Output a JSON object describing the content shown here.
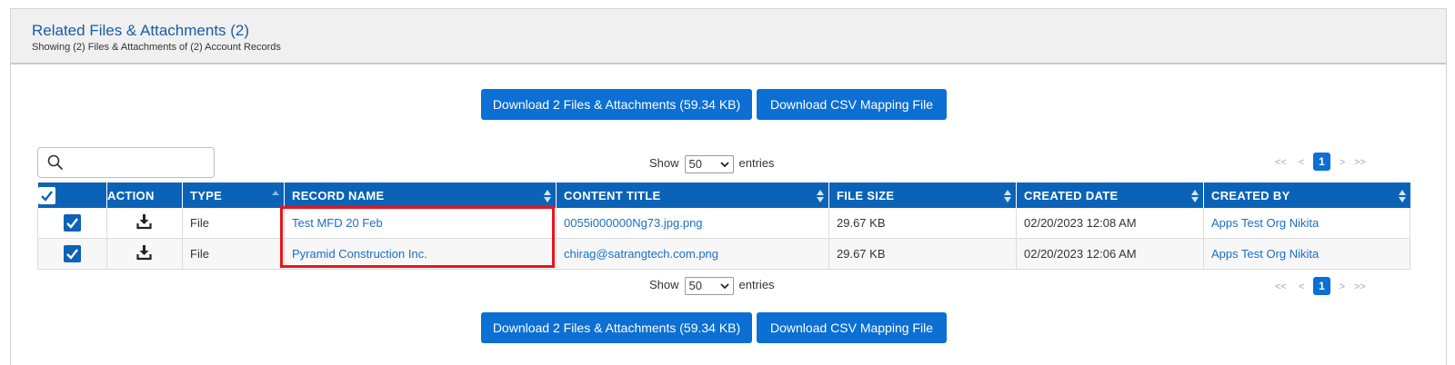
{
  "header": {
    "title": "Related Files & Attachments (2)",
    "subtitle": "Showing (2) Files & Attachments of (2) Account Records"
  },
  "actions": {
    "download_all_label": "Download 2 Files & Attachments (59.34 KB)",
    "download_csv_label": "Download CSV Mapping File"
  },
  "search": {
    "value": "",
    "placeholder": ""
  },
  "length_menu": {
    "prefix": "Show",
    "selected": "50",
    "suffix": "entries"
  },
  "pagination": {
    "first": "<<",
    "prev": "<",
    "current": "1",
    "next": ">",
    "last": ">>"
  },
  "table": {
    "columns": {
      "action": "ACTION",
      "type": "TYPE",
      "record_name": "RECORD NAME",
      "content_title": "CONTENT TITLE",
      "file_size": "FILE SIZE",
      "created_date": "CREATED DATE",
      "created_by": "CREATED BY"
    },
    "rows": [
      {
        "checked": true,
        "type": "File",
        "record_name": "Test MFD 20 Feb",
        "content_title": "0055i000000Ng73.jpg.png",
        "file_size": "29.67 KB",
        "created_date": "02/20/2023 12:08 AM",
        "created_by": "Apps Test Org Nikita"
      },
      {
        "checked": true,
        "type": "File",
        "record_name": "Pyramid Construction Inc.",
        "content_title": "chirag@satrangtech.com.png",
        "file_size": "29.67 KB",
        "created_date": "02/20/2023 12:06 AM",
        "created_by": "Apps Test Org Nikita"
      }
    ]
  },
  "colors": {
    "accent": "#0b6fd4",
    "table_header": "#0b63b8",
    "link": "#1a6fc7",
    "title": "#1a5ca8",
    "highlight": "#e8141d"
  }
}
